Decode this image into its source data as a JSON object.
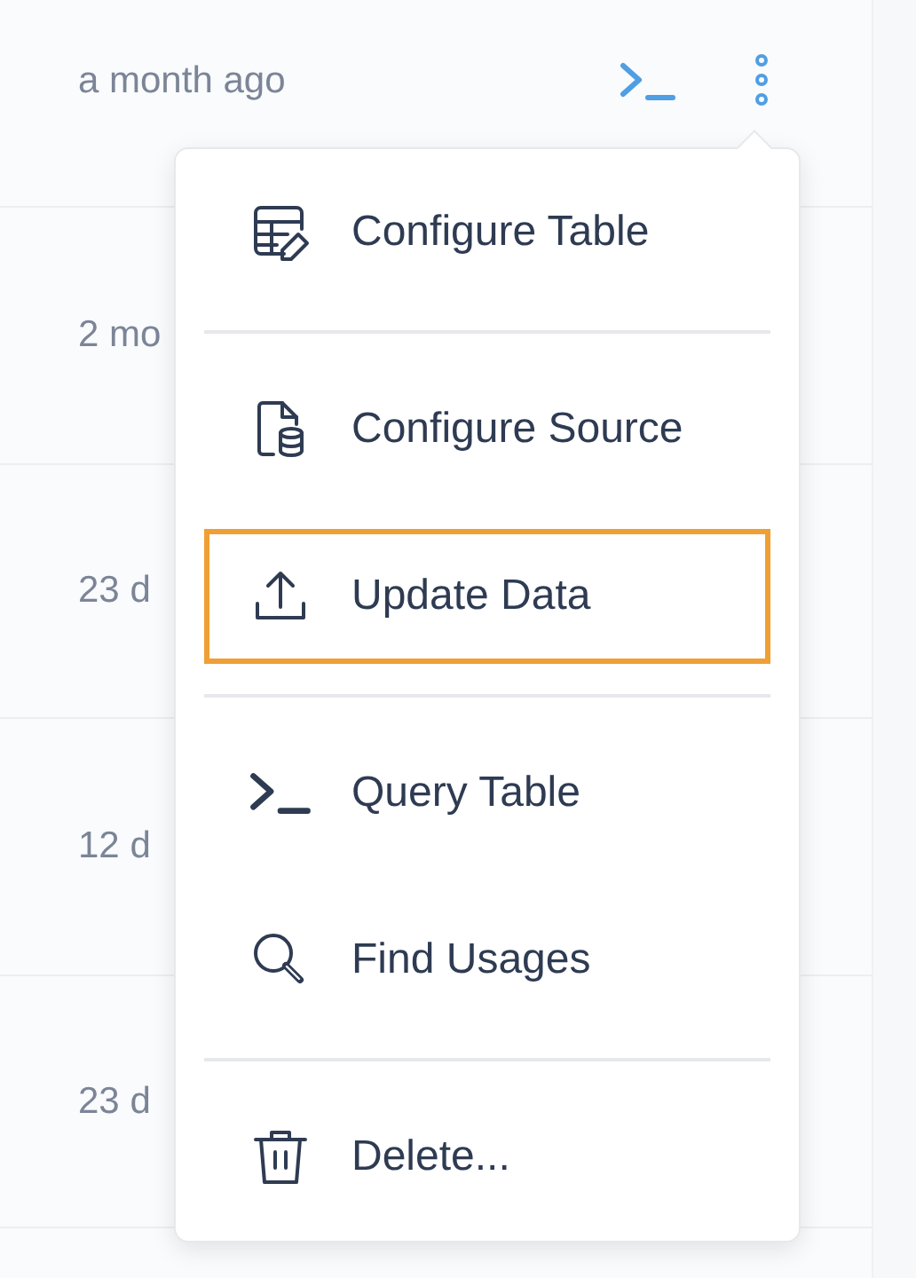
{
  "rows": [
    {
      "time": "a month ago",
      "actions": true
    },
    {
      "time": "2 mo"
    },
    {
      "time": "23 d"
    },
    {
      "time": "12 d"
    },
    {
      "time": "23 d"
    }
  ],
  "menu": {
    "sections": [
      [
        {
          "label": "Configure Table",
          "selected": false
        }
      ],
      [
        {
          "label": "Configure Source",
          "selected": false
        },
        {
          "label": "Update Data",
          "selected": true
        }
      ],
      [
        {
          "label": "Query Table",
          "selected": false
        },
        {
          "label": "Find Usages",
          "selected": false
        }
      ],
      [
        {
          "label": "Delete...",
          "selected": false
        }
      ]
    ]
  }
}
